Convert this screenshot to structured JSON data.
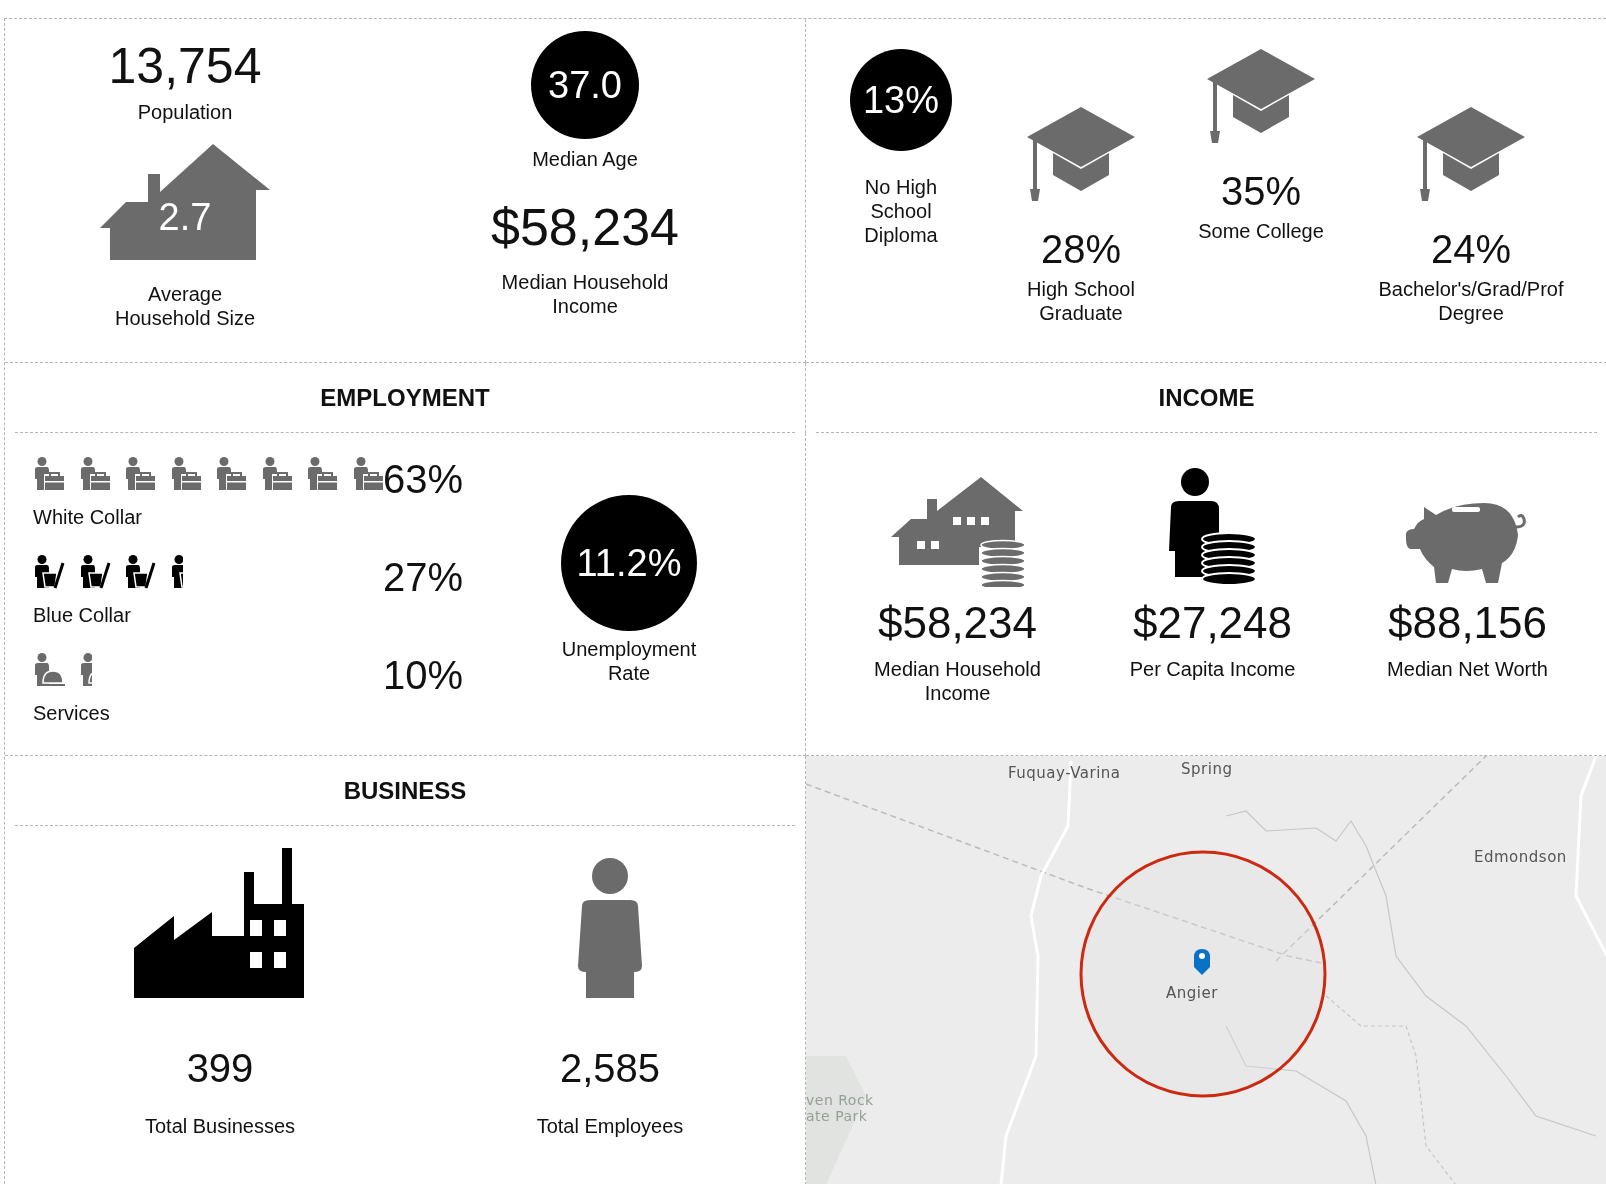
{
  "summary": {
    "population": {
      "value": "13,754",
      "label": "Population"
    },
    "household_size": {
      "value": "2.7",
      "label": "Average Household Size"
    },
    "median_age": {
      "value": "37.0",
      "label": "Median Age"
    },
    "median_income": {
      "value": "$58,234",
      "label": "Median Household Income"
    }
  },
  "education": [
    {
      "kind": "circle",
      "value": "13%",
      "label": "No High School Diploma"
    },
    {
      "kind": "cap",
      "value": "28%",
      "label": "High School Graduate"
    },
    {
      "kind": "cap",
      "value": "35%",
      "label": "Some College"
    },
    {
      "kind": "cap",
      "value": "24%",
      "label": "Bachelor's/Grad/Prof Degree"
    }
  ],
  "employment": {
    "title": "EMPLOYMENT",
    "groups": [
      {
        "kind": "white_collar",
        "label": "White Collar",
        "icons": [
          {
            "kind": "whole"
          },
          {
            "kind": "whole"
          },
          {
            "kind": "whole"
          },
          {
            "kind": "whole"
          },
          {
            "kind": "whole"
          },
          {
            "kind": "whole"
          },
          {
            "kind": "whole"
          },
          {
            "kind": "whole"
          }
        ],
        "percent": "63%"
      },
      {
        "kind": "blue_collar",
        "label": "Blue Collar",
        "icons": [
          {
            "kind": "whole"
          },
          {
            "kind": "whole"
          },
          {
            "kind": "whole"
          },
          {
            "kind": "part"
          }
        ],
        "percent": "27%"
      },
      {
        "kind": "services",
        "label": "Services",
        "icons": [
          {
            "kind": "whole"
          },
          {
            "kind": "part"
          }
        ],
        "percent": "10%"
      }
    ],
    "unemployment": {
      "value": "11.2%",
      "label": "Unemployment Rate"
    }
  },
  "income": {
    "title": "INCOME",
    "items": [
      {
        "kind": "house",
        "value": "$58,234",
        "label": "Median Household Income"
      },
      {
        "kind": "person",
        "value": "$27,248",
        "label": "Per Capita Income"
      },
      {
        "kind": "piggy",
        "value": "$88,156",
        "label": "Median Net Worth"
      }
    ]
  },
  "business": {
    "title": "BUSINESS",
    "items": [
      {
        "kind": "factory",
        "value": "399",
        "label": "Total Businesses"
      },
      {
        "kind": "person",
        "value": "2,585",
        "label": "Total Employees"
      }
    ]
  },
  "map": {
    "labels": [
      {
        "kind": "place",
        "text": "Fuquay-Varina"
      },
      {
        "kind": "place",
        "text": "Spring"
      },
      {
        "kind": "place",
        "text": "Edmondson"
      },
      {
        "kind": "park",
        "text": "ven Rock"
      },
      {
        "kind": "park",
        "text": "ate Park"
      }
    ],
    "marker": {
      "label": "Angier"
    }
  }
}
